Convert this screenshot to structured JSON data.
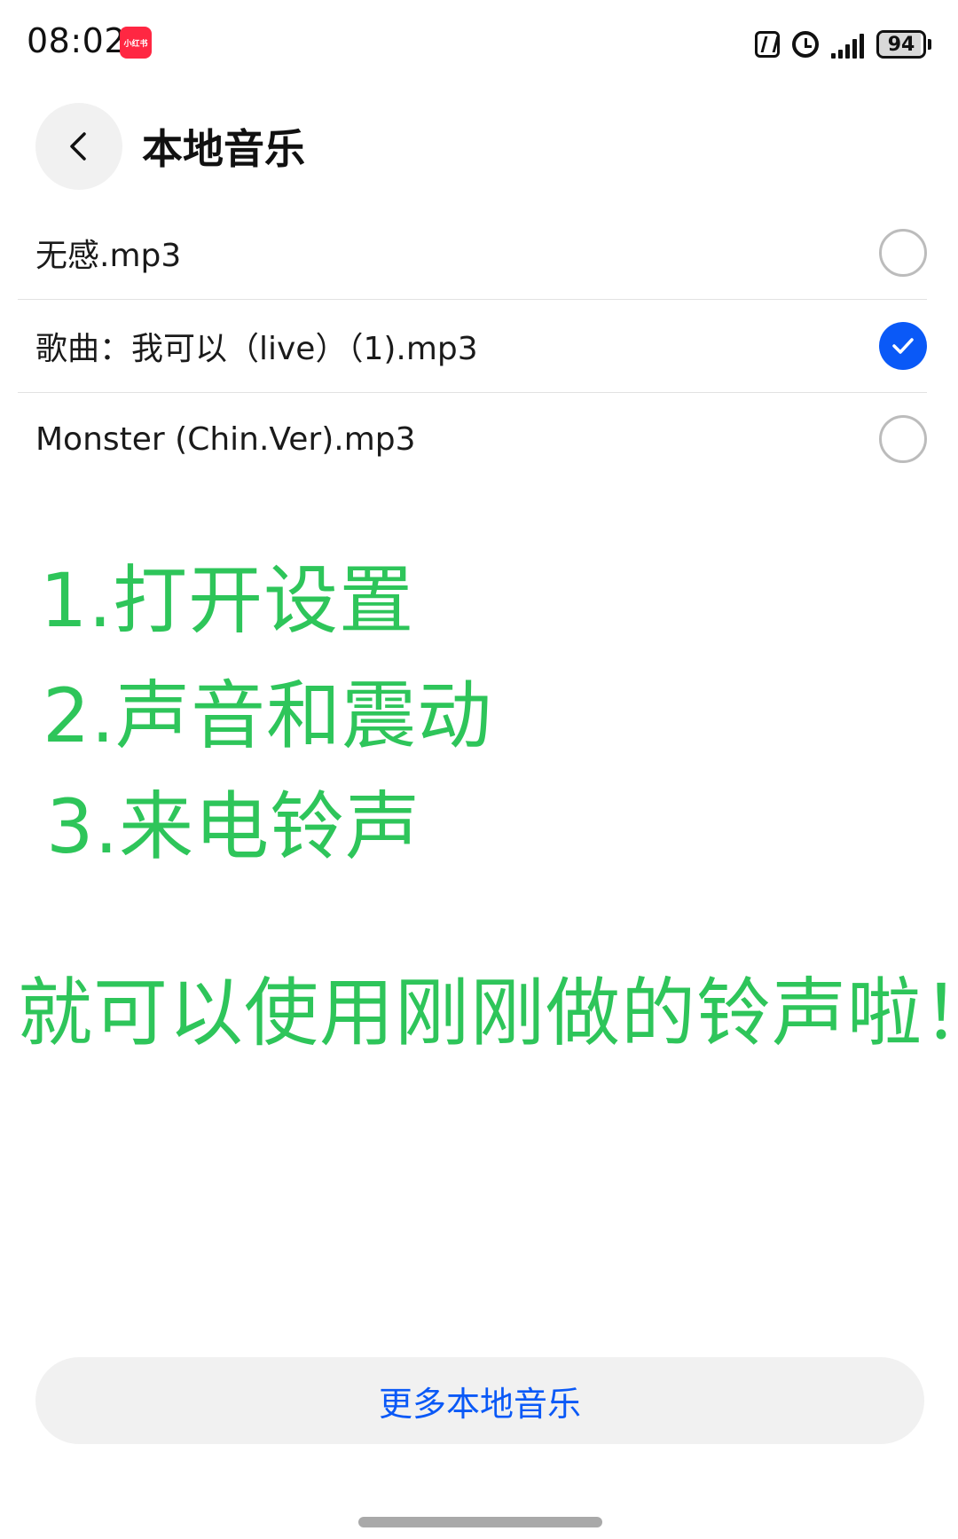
{
  "status_bar": {
    "time": "08:02",
    "app_badge": "小红书",
    "battery": "94",
    "icons": [
      "nfc-icon",
      "alarm-icon",
      "signal-icon",
      "battery-icon"
    ]
  },
  "header": {
    "back_icon": "chevron-left-icon",
    "title": "本地音乐"
  },
  "music_list": {
    "items": [
      {
        "label": "无感.mp3",
        "selected": false
      },
      {
        "label": "歌曲：我可以（live）（1).mp3",
        "selected": true
      },
      {
        "label": "Monster (Chin.Ver).mp3",
        "selected": false
      }
    ]
  },
  "instructions": {
    "step1": "1.打开设置",
    "step2": "2.声音和震动",
    "step3": "3.来电铃声",
    "tip": "就可以使用刚刚做的铃声啦！"
  },
  "footer": {
    "more_button": "更多本地音乐"
  },
  "colors": {
    "accent": "#0a59f7",
    "overlay_text": "#2ec55a",
    "button_bg": "#f1f1f1"
  }
}
